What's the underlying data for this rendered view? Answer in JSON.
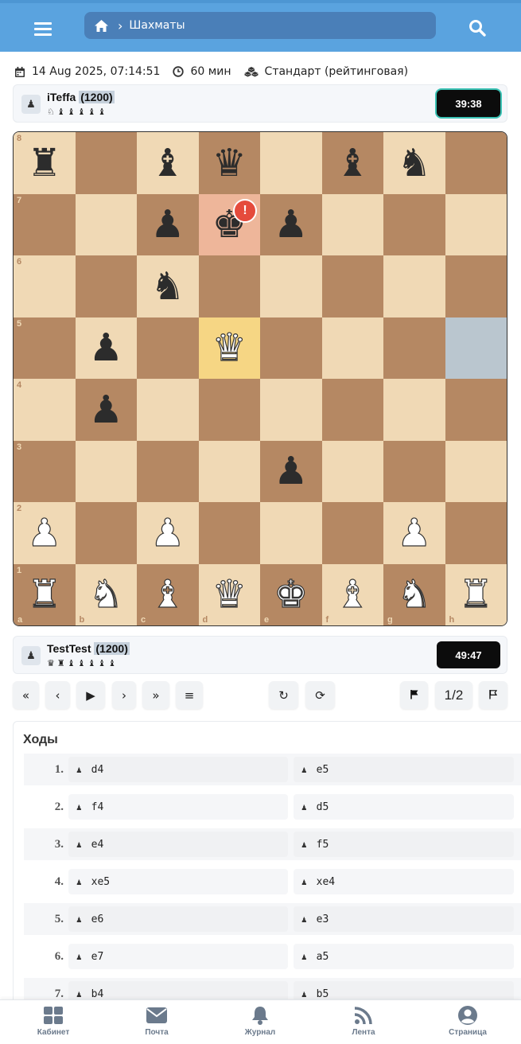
{
  "topbar": {
    "breadcrumb": "Шахматы",
    "menu_icon": "menu-icon",
    "home_icon": "home-icon",
    "search_icon": "search-icon"
  },
  "game_info": {
    "date": "14 Aug 2025, 07:14:51",
    "time_control": "60 мин",
    "mode": "Стандарт (рейтинговая)"
  },
  "opponent": {
    "name": "iTeffa",
    "rating": "(1200)",
    "captured": "♘♝♝♝♝♝",
    "clock": "39:38"
  },
  "player": {
    "name": "TestTest",
    "rating": "(1200)",
    "captured": "♛♜♝♝♝♝♝",
    "clock": "49:47"
  },
  "board": {
    "files": [
      "a",
      "b",
      "c",
      "d",
      "e",
      "f",
      "g",
      "h"
    ],
    "ranks": [
      "8",
      "7",
      "6",
      "5",
      "4",
      "3",
      "2",
      "1"
    ],
    "rows": [
      [
        "bR",
        "",
        "bB",
        "bQ",
        "",
        "bB",
        "bN",
        ""
      ],
      [
        "",
        "",
        "bP",
        "bK",
        "bP",
        "",
        "",
        ""
      ],
      [
        "",
        "",
        "bN",
        "",
        "",
        "",
        "",
        ""
      ],
      [
        "",
        "bP",
        "",
        "wQ",
        "",
        "",
        "",
        ""
      ],
      [
        "",
        "bP",
        "",
        "",
        "",
        "",
        "",
        ""
      ],
      [
        "",
        "",
        "",
        "",
        "bP",
        "",
        "",
        ""
      ],
      [
        "wP",
        "",
        "wP",
        "",
        "",
        "",
        "wP",
        ""
      ],
      [
        "wR",
        "wN",
        "wB",
        "wQ",
        "wK",
        "wB",
        "wN",
        "wR"
      ]
    ],
    "last_move_square": "d5",
    "from_square": "h5",
    "check_square": "d7",
    "check_badge": "!"
  },
  "controls": {
    "first": "«",
    "prev": "‹",
    "play": "▶",
    "next": "›",
    "last": "»",
    "list": "≡",
    "undo": "↻",
    "redo": "⟳",
    "resign_icon": "flag-filled-icon",
    "draw": "1/2",
    "flag_icon": "flag-outline-icon"
  },
  "moves": {
    "title": "Ходы",
    "list": [
      {
        "n": "1.",
        "w": "d4",
        "b": "e5"
      },
      {
        "n": "2.",
        "w": "f4",
        "b": "d5"
      },
      {
        "n": "3.",
        "w": "e4",
        "b": "f5"
      },
      {
        "n": "4.",
        "w": "xe5",
        "b": "xe4"
      },
      {
        "n": "5.",
        "w": "e6",
        "b": "e3"
      },
      {
        "n": "6.",
        "w": "e7",
        "b": "a5"
      },
      {
        "n": "7.",
        "w": "b4",
        "b": "b5"
      }
    ]
  },
  "nav": [
    {
      "label": "Кабинет",
      "icon": "grid-icon"
    },
    {
      "label": "Почта",
      "icon": "mail-icon"
    },
    {
      "label": "Журнал",
      "icon": "bell-icon"
    },
    {
      "label": "Лента",
      "icon": "rss-icon"
    },
    {
      "label": "Страница",
      "icon": "user-circle-icon"
    }
  ],
  "colors": {
    "topbar": "#5aa3df",
    "light_square": "#f0d9b5",
    "dark_square": "#b58863",
    "last_move": "#f6d684",
    "check": "#e54b3c"
  }
}
